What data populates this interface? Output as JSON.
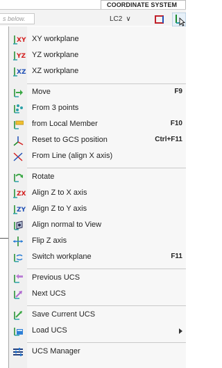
{
  "ribbon": {
    "tab_title": "COORDINATE SYSTEM",
    "search_placeholder": "s below.",
    "load_case_value": "LC2",
    "load_case_chevron": "∨"
  },
  "menu": {
    "xy_workplane": "XY workplane",
    "yz_workplane": "YZ workplane",
    "xz_workplane": "XZ workplane",
    "move": "Move",
    "move_shortcut": "F9",
    "from_3_points": "From 3 points",
    "from_local_member": "from Local Member",
    "from_local_member_shortcut": "F10",
    "reset_to_gcs": "Reset to GCS position",
    "reset_to_gcs_shortcut": "Ctrl+F11",
    "from_line": "From Line (align X axis)",
    "rotate": "Rotate",
    "align_z_to_x": "Align Z to X axis",
    "align_z_to_y": "Align Z to Y axis",
    "align_normal": "Align normal to View",
    "flip_z": "Flip Z axis",
    "switch_workplane": "Switch workplane",
    "switch_workplane_shortcut": "F11",
    "previous_ucs": "Previous UCS",
    "next_ucs": "Next UCS",
    "save_current_ucs": "Save Current UCS",
    "load_ucs": "Load UCS",
    "ucs_manager": "UCS Manager"
  },
  "icon_glyphs": {
    "xy": "XY",
    "yz": "YZ",
    "xz": "XZ",
    "zx": "ZX",
    "zy": "ZY"
  },
  "colors": {
    "axis_red": "#d42020",
    "axis_blue": "#1f4fb5",
    "axis_green": "#1a8a2a",
    "arrow_green": "#3aa845",
    "arrow_blue": "#2d7fd6",
    "accent_teal": "#2aa0a8",
    "folder_yellow": "#f0c030"
  }
}
